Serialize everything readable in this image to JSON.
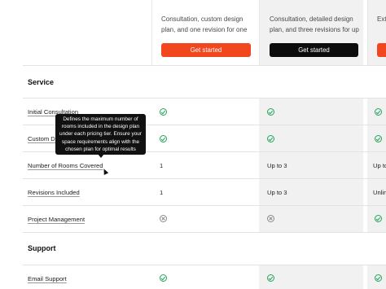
{
  "plans": [
    {
      "description": "Consultation, custom design plan, and one revision for one room. Id...",
      "button_label": "Get started",
      "button_color": "#f2461e"
    },
    {
      "description": "Consultation, detailed design plan, and three revisions for up to thre...",
      "button_label": "Get started",
      "button_color": "#0c0c0c"
    },
    {
      "description": "Ext...",
      "button_label": "",
      "button_color": "#f2461e"
    }
  ],
  "sections": {
    "service": "Service",
    "support": "Support"
  },
  "features": {
    "initial_consultation": {
      "label": "Initial Consultation",
      "values": [
        "check",
        "check",
        "check"
      ]
    },
    "custom_design": {
      "label": "Custom De",
      "values": [
        "check",
        "check",
        "check"
      ]
    },
    "rooms_covered": {
      "label": "Number of Rooms Covered",
      "values": [
        "1",
        "Up to 3",
        "Up to"
      ]
    },
    "revisions": {
      "label": "Revisions Included",
      "values": [
        "1",
        "Up to 3",
        "Unlin"
      ]
    },
    "project_management": {
      "label": "Project Management",
      "values": [
        "cross",
        "cross",
        "check"
      ]
    },
    "email_support": {
      "label": "Email Support",
      "values": [
        "check",
        "check",
        "check"
      ]
    }
  },
  "tooltip": {
    "text": "Defines the maximum number of rooms included in the design plan under each pricing tier. Ensure your space requirements align with the chosen plan for optimal results"
  },
  "colors": {
    "check": "#21a55b",
    "cross": "#8a8a8a",
    "shaded_column": "#f1f1f1"
  }
}
